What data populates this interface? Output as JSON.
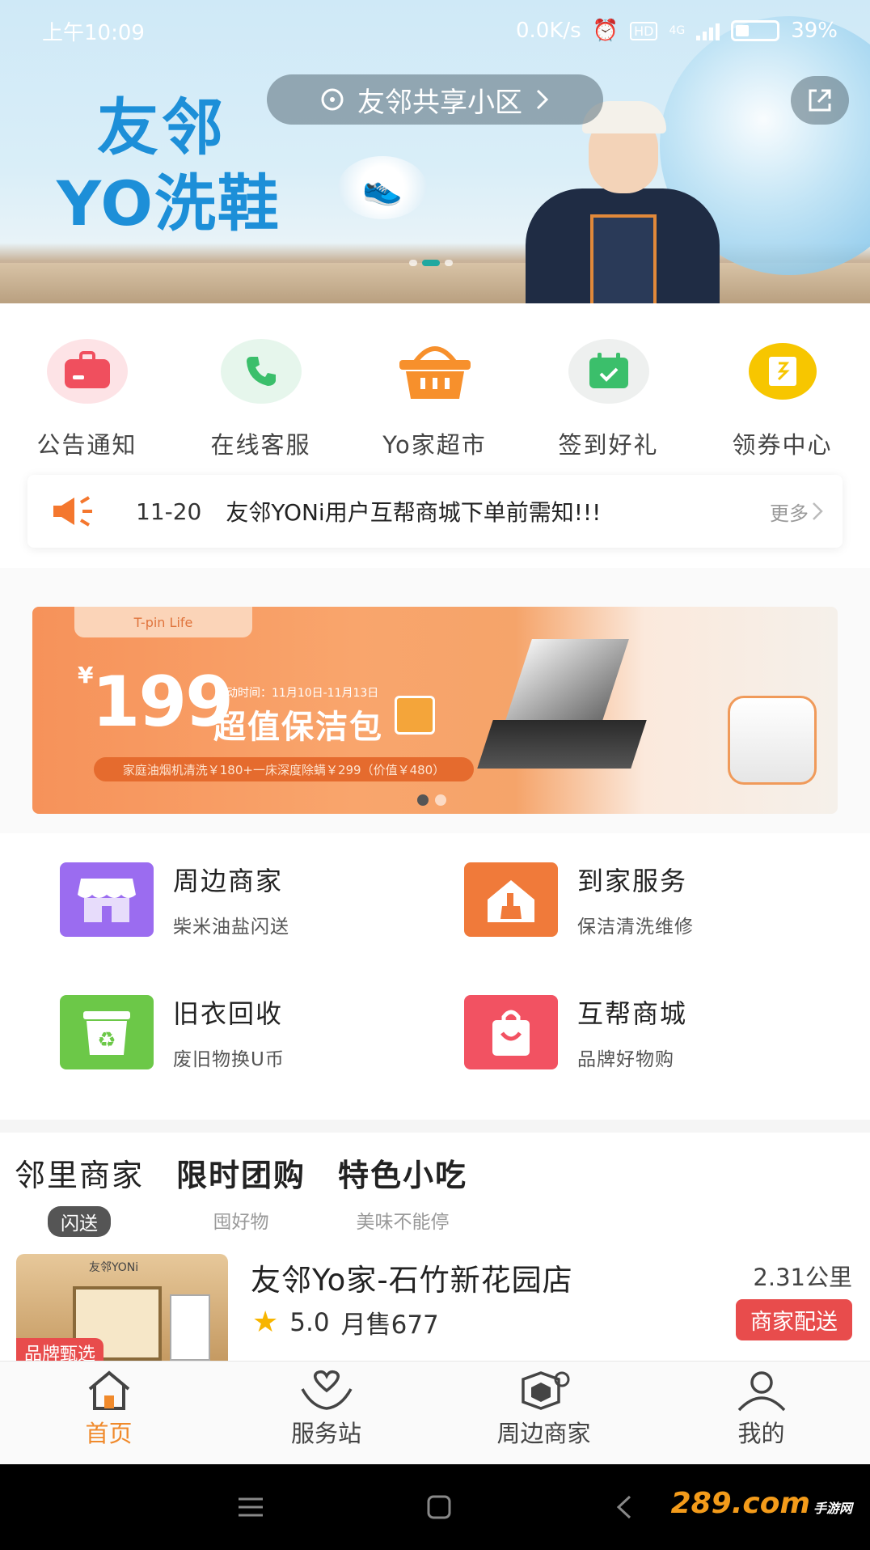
{
  "status_bar": {
    "time": "上午10:09",
    "net_speed": "0.0K/s",
    "net_type": "4G",
    "hd": "HD",
    "battery": "39%"
  },
  "hero": {
    "brand_line1": "友邻",
    "brand_line2": "YO洗鞋",
    "community": "友邻共享小区",
    "slide_index": 1,
    "slide_count": 3
  },
  "quick_actions": [
    {
      "label": "公告通知",
      "icon": "notice-icon",
      "color": "#f04f5e",
      "bg": "#fde3e6"
    },
    {
      "label": "在线客服",
      "icon": "phone-icon",
      "color": "#3bbf6b",
      "bg": "#e6f6ec"
    },
    {
      "label": "Yo家超市",
      "icon": "basket-icon",
      "color": "#f7902c",
      "bg": "#ffffff"
    },
    {
      "label": "签到好礼",
      "icon": "calendar-check-icon",
      "color": "#3bbf6b",
      "bg": "#eef0ef"
    },
    {
      "label": "领券中心",
      "icon": "coupon-icon",
      "color": "#f7c600",
      "bg": "#ffffff"
    }
  ],
  "notice": {
    "date": "11-20",
    "text": "友邻YONi用户互帮商城下单前需知!!!",
    "more": "更多"
  },
  "promo": {
    "brand": "T-pin Life",
    "currency": "¥",
    "price": "199",
    "date_text": "活动时间：11月10日-11月13日",
    "headline": "超值保洁包",
    "detail": "家庭油烟机清洗￥180+一床深度除螨￥299（价值￥480）",
    "slide_index": 0,
    "slide_count": 2
  },
  "services": [
    {
      "title": "周边商家",
      "subtitle": "柴米油盐闪送",
      "icon": "shop-icon",
      "color": "#9b6cf0"
    },
    {
      "title": "到家服务",
      "subtitle": "保洁清洗维修",
      "icon": "home-broom-icon",
      "color": "#f07a3a"
    },
    {
      "title": "旧衣回收",
      "subtitle": "废旧物换U币",
      "icon": "recycle-bin-icon",
      "color": "#6cc848"
    },
    {
      "title": "互帮商城",
      "subtitle": "品牌好物购",
      "icon": "shopping-bag-icon",
      "color": "#f25262"
    }
  ],
  "merchant_tabs": [
    {
      "title": "邻里商家",
      "subtitle": "闪送"
    },
    {
      "title": "限时团购",
      "subtitle": "囤好物"
    },
    {
      "title": "特色小吃",
      "subtitle": "美味不能停"
    }
  ],
  "shop": {
    "thumb_sign": "友邻YONi",
    "thumb_tag": "品牌甄选",
    "name": "友邻Yo家-石竹新花园店",
    "distance": "2.31公里",
    "rating": "5.0",
    "monthly_sales": "月售677",
    "delivery": "商家配送"
  },
  "tabbar": [
    {
      "label": "首页",
      "icon": "home-icon",
      "active": true
    },
    {
      "label": "服务站",
      "icon": "heart-hands-icon",
      "active": false
    },
    {
      "label": "周边商家",
      "icon": "nearby-shop-icon",
      "active": false
    },
    {
      "label": "我的",
      "icon": "profile-icon",
      "active": false
    }
  ],
  "watermark": {
    "main": "289.com",
    "sub": "手游网"
  },
  "colors": {
    "accent": "#f08a2c",
    "red": "#e84c4c"
  }
}
